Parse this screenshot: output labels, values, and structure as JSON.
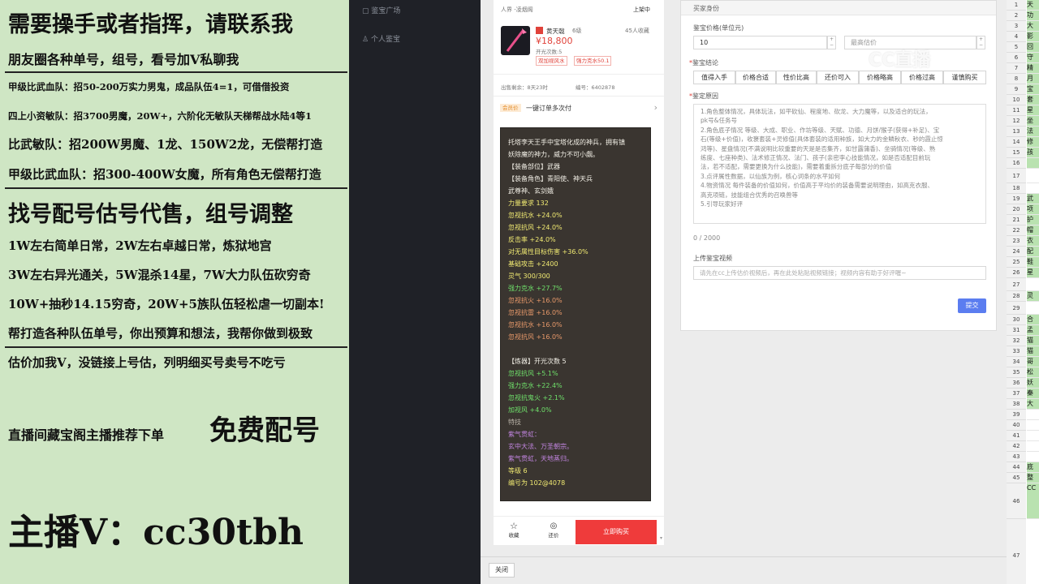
{
  "overlay": {
    "lines": [
      "需要操手或者指挥，请联系我",
      "朋友圈各种单号，组号，看号加V私聊我",
      "甲级比武血队：招50-200万实力男鬼，成品队伍4=1，可借借投资",
      "四上小资敏队：招3700男魔，20W+，六阶化无敏队天梯帮战水陆4等1",
      "比武敏队：招200W男魔、1龙、150W2龙，无偿帮打造",
      "甲级比武血队：招300-400W女魔，所有角色无偿帮打造",
      "找号配号估号代售，组号调整",
      "1W左右简单日常，2W左右卓越日常，炼狱地宫",
      "3W左右异光通关，5W混杀14星，7W大力队伍砍穷奇",
      "10W+抽秒14.15穷奇，20W+5族队伍轻松虐一切副本!",
      "帮打造各种队伍单号，你出预算和想法，我帮你做到极致",
      "估价加我V，没链接上号估，列明细买号卖号不吃亏",
      "直播间藏宝阁主播推荐下单",
      "免费配号",
      "主播V：cc30tbh"
    ]
  },
  "sidebar": {
    "items": [
      "鉴宝广场",
      "个人鉴宝"
    ]
  },
  "listing": {
    "server": "人界 -凌烟阁",
    "status": "上架中",
    "item_name": "黄天戟",
    "level": "6级",
    "favorites": "45人收藏",
    "price": "¥18,800",
    "sub_info": "开光次数:5",
    "tags": [
      "双加视风水",
      "强力克水50.1"
    ],
    "remaining_label": "出售剩余：",
    "remaining_value": "8天23时",
    "code_label": "编号：",
    "code_value": "6402878",
    "promo_badge": "会员价",
    "promo_text": "一键订单多次付",
    "desc_lines": [
      "托塔李天王手中宝塔化成的神兵，拥有镇",
      "妖除魔的神力，威力不可小觑。",
      "【装备部位】武器",
      "【装备角色】青阳使、神天兵",
      "武尊神、玄剑娥",
      "力量要求 132",
      "忽视抗水 +24.0%",
      "忽视抗风 +24.0%",
      "反击率 +24.0%",
      "对无属性目标伤害 +36.0%",
      "基础攻击 +2400",
      "灵气 300/300",
      "强力克水 +27.7%",
      "忽视抗火 +16.0%",
      "忽视抗雷 +16.0%",
      "忽视抗水 +16.0%",
      "忽视抗风 +16.0%",
      "",
      "【炼器】开光次数 5",
      "忽视抗风 +5.1%",
      "强力克水 +22.4%",
      "忽视抗鬼火 +2.1%",
      "加视风 +4.0%",
      "特技",
      "紫气贯虹：",
      "玄中大法、万圣朝宗。",
      "紫气贯虹，天地蒸归。",
      "等级 6",
      "编号为 102@4078"
    ],
    "bottom": {
      "fav_label": "收藏",
      "bargain_label": "还价",
      "buy_label": "立即购买"
    }
  },
  "form": {
    "section_title": "买家身份",
    "price_label": "鉴宝价格(单位元)",
    "price_value": "10",
    "max_placeholder": "最高估价",
    "conclusion_label": "鉴宝结论",
    "conclusion_options": [
      "值得入手",
      "价格合适",
      "性价比高",
      "还价可入",
      "价格略高",
      "价格过高",
      "谨慎购买"
    ],
    "reason_label": "鉴定原因",
    "reason_lines": [
      "1.角色整体情况，具体玩法，如平砍仙、程度地、砍龙、大力魔等，以及适合的玩法，",
      "pk号&任务号",
      "2.角色底子情况 等级、大成、职业、作坊等级、天赋、功德、月饼/猴子(获得+补足)、宝",
      "石(等级+价值)，收褒套装+灵修值(具体套装的适用种族，如大力的金鳞秋衣、秒的霞止惊",
      "鸿等)、星盘情况(不满说明比较重要的天是是否集齐，如甘露蒲香)、坐骑情况(等级、熟",
      "练度、七座种类)、法术修正情况、法门、孩子(亲密李心技能情况，如是否适配目前玩",
      "法，若不适配，需要更换为什么技能)，需要着重拆分底子每部分的价值",
      "3.点评属性数据，以仙族为例，核心词条的水平如何",
      "4.物资情况 每件装备的价值如何，价值高于平均价的装备需要说明理由，如高克衣服、",
      "高克项链，技能组合优秀的召唤兽等",
      "5.引导玩家好评"
    ],
    "counter": "0 / 2000",
    "video_label": "上传鉴宝视频",
    "video_placeholder": "请先在cc上传估价视频后，再在此处粘贴视频链接；视频内容有助于好评喔~",
    "submit_label": "提交"
  },
  "close_label": "关闭",
  "watermark": "CC直播",
  "sheet": {
    "rows": [
      {
        "n": "1",
        "t": "天"
      },
      {
        "n": "2",
        "t": "功"
      },
      {
        "n": "3",
        "t": "大"
      },
      {
        "n": "4",
        "t": "影"
      },
      {
        "n": "5",
        "t": "回"
      },
      {
        "n": "6",
        "t": "守"
      },
      {
        "n": "7",
        "t": "精"
      },
      {
        "n": "8",
        "t": "月"
      },
      {
        "n": "9",
        "t": "宝"
      },
      {
        "n": "10",
        "t": "套"
      },
      {
        "n": "11",
        "t": "星"
      },
      {
        "n": "12",
        "t": "坐"
      },
      {
        "n": "13",
        "t": "法"
      },
      {
        "n": "14",
        "t": "修"
      },
      {
        "n": "15",
        "t": "孩"
      },
      {
        "n": "16",
        "t": ""
      },
      {
        "n": "17",
        "t": ""
      },
      {
        "n": "18",
        "t": ""
      },
      {
        "n": "19",
        "t": "武"
      },
      {
        "n": "20",
        "t": "项"
      },
      {
        "n": "21",
        "t": "护"
      },
      {
        "n": "22",
        "t": "帽"
      },
      {
        "n": "23",
        "t": "衣"
      },
      {
        "n": "24",
        "t": "配"
      },
      {
        "n": "25",
        "t": "鞋"
      },
      {
        "n": "26",
        "t": "星"
      },
      {
        "n": "27",
        "t": ""
      },
      {
        "n": "28",
        "t": "灵"
      },
      {
        "n": "29",
        "t": ""
      },
      {
        "n": "30",
        "t": "合"
      },
      {
        "n": "31",
        "t": "孟"
      },
      {
        "n": "32",
        "t": "猫"
      },
      {
        "n": "33",
        "t": "猫"
      },
      {
        "n": "34",
        "t": "哥"
      },
      {
        "n": "35",
        "t": "松"
      },
      {
        "n": "36",
        "t": "妖"
      },
      {
        "n": "37",
        "t": "秦"
      },
      {
        "n": "38",
        "t": "大"
      },
      {
        "n": "39",
        "t": ""
      },
      {
        "n": "40",
        "t": ""
      },
      {
        "n": "41",
        "t": ""
      },
      {
        "n": "42",
        "t": ""
      },
      {
        "n": "43",
        "t": ""
      },
      {
        "n": "44",
        "t": "底"
      },
      {
        "n": "45",
        "t": "整"
      },
      {
        "n": "46",
        "t": "CC"
      },
      {
        "n": "47",
        "t": ""
      },
      {
        "n": "48",
        "t": ""
      },
      {
        "n": "49",
        "t": ""
      }
    ]
  },
  "colors": {
    "overlay_bg": "#cfe6c4",
    "sidebar_bg": "#1f2127",
    "price_red": "#e0423a",
    "buy_red": "#ef3b3b",
    "submit_blue": "#5b7df0",
    "sheet_green": "#b9e2b0"
  }
}
